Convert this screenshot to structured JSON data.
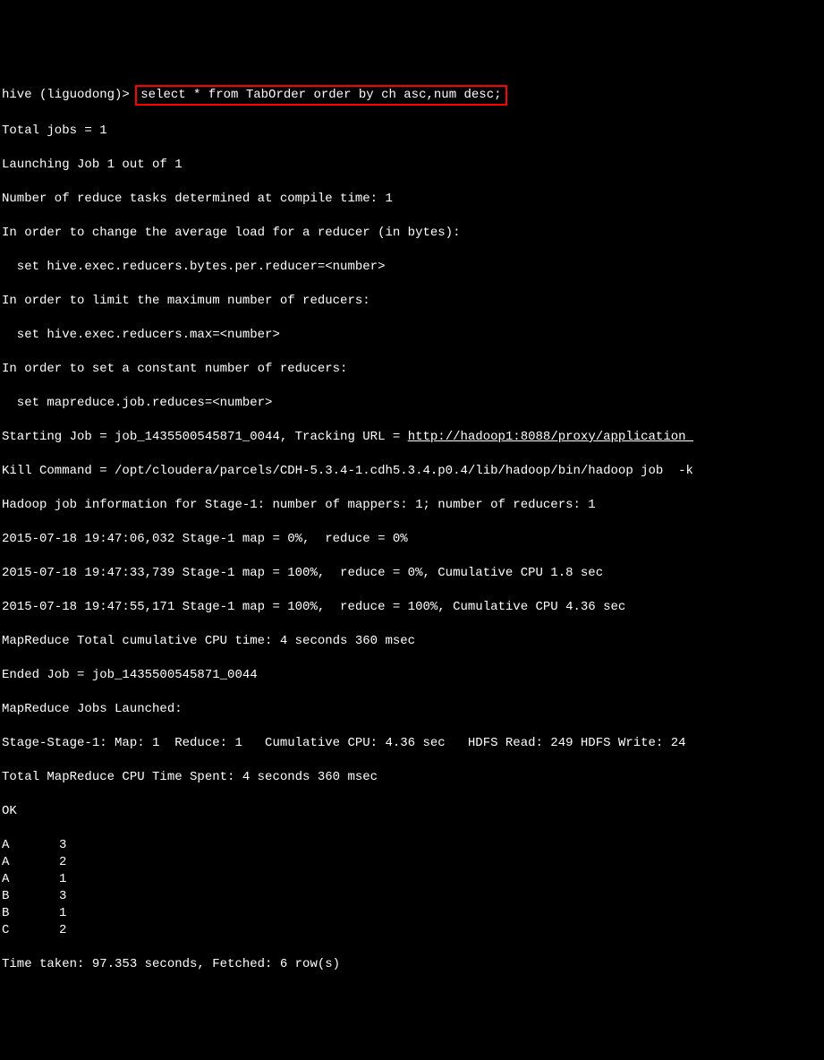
{
  "prompt": "hive (liguodong)> ",
  "query": "select * from TabOrder order by ch asc,num desc;",
  "lines": {
    "l1": "Total jobs = 1",
    "l2": "Launching Job 1 out of 1",
    "l3": "Number of reduce tasks determined at compile time: 1",
    "l4": "In order to change the average load for a reducer (in bytes):",
    "l5": "  set hive.exec.reducers.bytes.per.reducer=<number>",
    "l6": "In order to limit the maximum number of reducers:",
    "l7": "  set hive.exec.reducers.max=<number>",
    "l8": "In order to set a constant number of reducers:",
    "l9": "  set mapreduce.job.reduces=<number>",
    "l10a": "Starting Job = job_1435500545871_0044, Tracking URL = ",
    "l10b": "http://hadoop1:8088/proxy/application_",
    "l11": "Kill Command = /opt/cloudera/parcels/CDH-5.3.4-1.cdh5.3.4.p0.4/lib/hadoop/bin/hadoop job  -k",
    "l12": "Hadoop job information for Stage-1: number of mappers: 1; number of reducers: 1",
    "l13": "2015-07-18 19:47:06,032 Stage-1 map = 0%,  reduce = 0%",
    "l14": "2015-07-18 19:47:33,739 Stage-1 map = 100%,  reduce = 0%, Cumulative CPU 1.8 sec",
    "l15": "2015-07-18 19:47:55,171 Stage-1 map = 100%,  reduce = 100%, Cumulative CPU 4.36 sec",
    "l16": "MapReduce Total cumulative CPU time: 4 seconds 360 msec",
    "l17": "Ended Job = job_1435500545871_0044",
    "l18": "MapReduce Jobs Launched:",
    "l19": "Stage-Stage-1: Map: 1  Reduce: 1   Cumulative CPU: 4.36 sec   HDFS Read: 249 HDFS Write: 24",
    "l20": "Total MapReduce CPU Time Spent: 4 seconds 360 msec",
    "l21": "OK"
  },
  "results": [
    {
      "ch": "A",
      "num": "3"
    },
    {
      "ch": "A",
      "num": "2"
    },
    {
      "ch": "A",
      "num": "1"
    },
    {
      "ch": "B",
      "num": "3"
    },
    {
      "ch": "B",
      "num": "1"
    },
    {
      "ch": "C",
      "num": "2"
    }
  ],
  "footer": "Time taken: 97.353 seconds, Fetched: 6 row(s)"
}
